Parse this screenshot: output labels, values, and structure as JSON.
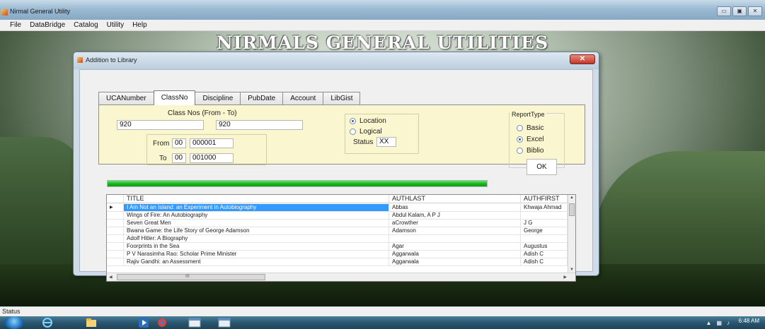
{
  "window": {
    "title": "Nirmal General Utility",
    "controls": [
      "▭",
      "▣",
      "✕"
    ]
  },
  "menu": [
    "File",
    "DataBridge",
    "Catalog",
    "Utility",
    "Help"
  ],
  "banner": "NIRMALS GENERAL UTILITIES",
  "dialog": {
    "title": "Addition to Library",
    "close_label": "✕",
    "tabs": [
      "UCANumber",
      "ClassNo",
      "Discipline",
      "PubDate",
      "Account",
      "LibGist"
    ],
    "active_tab": "ClassNo",
    "class_nos_label": "Class Nos (From - To)",
    "class_from": "920",
    "class_to": "920",
    "from_label": "From",
    "from_prefix": "00",
    "from_value": "000001",
    "to_label": "To",
    "to_prefix": "00",
    "to_value": "001000",
    "location_label": "Location",
    "logical_label": "Logical",
    "location_selected": "Location",
    "status_label": "Status",
    "status_value": "XX",
    "report_type_label": "ReportType",
    "report_options": [
      "Basic",
      "Excel",
      "Biblio"
    ],
    "report_selected": "Excel",
    "ok_label": "OK",
    "progress": 1.0
  },
  "grid": {
    "columns": [
      "TITLE",
      "AUTHLAST",
      "AUTHFIRST"
    ],
    "rows": [
      {
        "title": "I Am Not an Island: an Experiment in Autobiography",
        "last": "Abbas",
        "first": "Khwaja Ahmad",
        "selected": true
      },
      {
        "title": "Wings of Fire: An Autobiography",
        "last": "Abdul Kalam, A P J",
        "first": ""
      },
      {
        "title": "Seven Great Men",
        "last": "aCrowther",
        "first": "J G"
      },
      {
        "title": "Bwana Game: the Life Story of George Adamson",
        "last": "Adamson",
        "first": "George"
      },
      {
        "title": "Adolf Hitler: A Biography",
        "last": "",
        "first": ""
      },
      {
        "title": "Foorprints in the Sea",
        "last": "Agar",
        "first": "Augustus"
      },
      {
        "title": "P V Narasimha Rao: Scholar Prime Minister",
        "last": "Aggarwala",
        "first": "Adish C"
      },
      {
        "title": "Rajiv Gandhi: an Assessment",
        "last": "Aggarwala",
        "first": "Adish C"
      }
    ],
    "scroll_marker": "III"
  },
  "statusbar": {
    "text": "Status"
  },
  "taskbar": {
    "time": "6:48 AM"
  },
  "colors": {
    "progress": "#16b51f",
    "selection": "#3399ff",
    "tab_panel": "#faf6cf"
  }
}
